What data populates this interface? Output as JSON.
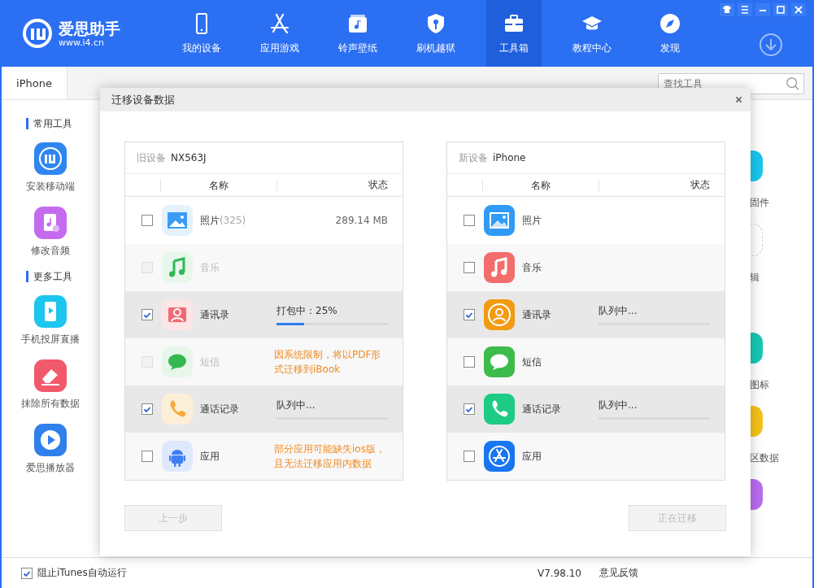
{
  "header": {
    "brand": "爱思助手",
    "url": "www.i4.cn",
    "nav": [
      {
        "label": "我的设备",
        "kind": "phone",
        "selected": false
      },
      {
        "label": "应用游戏",
        "kind": "apps",
        "selected": false
      },
      {
        "label": "铃声壁纸",
        "kind": "ringtone",
        "selected": false
      },
      {
        "label": "刷机越狱",
        "kind": "shield",
        "selected": false
      },
      {
        "label": "工具箱",
        "kind": "toolbox",
        "selected": true
      },
      {
        "label": "教程中心",
        "kind": "cap",
        "selected": false
      },
      {
        "label": "发现",
        "kind": "compass",
        "selected": false
      }
    ]
  },
  "tabs": [
    {
      "label": "iPhone",
      "selected": true
    }
  ],
  "search": {
    "placeholder": "查找工具"
  },
  "sections": [
    {
      "title": "常用工具",
      "tools": [
        {
          "label": "安装移动端",
          "kind": "i4"
        },
        {
          "label": "修改音频",
          "kind": "audio"
        }
      ]
    },
    {
      "title": "更多工具",
      "tools": [
        {
          "label": "手机投屏直播",
          "kind": "mirror"
        },
        {
          "label": "抹除所有数据",
          "kind": "erase"
        },
        {
          "label": "爱思播放器",
          "kind": "player"
        }
      ]
    }
  ],
  "right_tools": [
    {
      "label": "固件",
      "kind": "cyan"
    },
    {
      "label": "辑",
      "kind": "dashed"
    },
    {
      "label": "图标",
      "kind": "teal"
    },
    {
      "label": "区数据",
      "kind": "yellow"
    },
    {
      "kind": "purple"
    }
  ],
  "dialog": {
    "title": "迁移设备数据",
    "panels": [
      {
        "kind": "source",
        "caption": "旧设备",
        "device": "NX563J",
        "columns": [
          "名称",
          "状态"
        ],
        "rows": [
          {
            "name": "照片",
            "count": "(325)",
            "checked": false,
            "disabled": false,
            "status": {
              "kind": "text",
              "text": "289.14 MB"
            }
          },
          {
            "name": "音乐",
            "checked": false,
            "disabled": true
          },
          {
            "name": "通讯录",
            "checked": true,
            "disabled": false,
            "status": {
              "kind": "progress",
              "text": "打包中：25%",
              "level": 0.25
            }
          },
          {
            "name": "短信",
            "checked": false,
            "disabled": true,
            "status": {
              "kind": "note",
              "text": "因系统限制，将以PDF形式迁移到iBook"
            }
          },
          {
            "name": "通话记录",
            "checked": true,
            "disabled": false,
            "status": {
              "kind": "progress",
              "text": "队列中..."
            }
          },
          {
            "name": "应用",
            "checked": false,
            "disabled": false,
            "status": {
              "kind": "note",
              "text": "部分应用可能缺失ios版，且无法迁移应用内数据"
            }
          }
        ]
      },
      {
        "kind": "target",
        "caption": "新设备",
        "device": "iPhone",
        "columns": [
          "名称",
          "状态"
        ],
        "rows": [
          {
            "name": "照片",
            "checked": false,
            "disabled": false
          },
          {
            "name": "音乐",
            "checked": false,
            "disabled": false
          },
          {
            "name": "通讯录",
            "checked": true,
            "disabled": false,
            "status": {
              "kind": "progress",
              "text": "队列中..."
            }
          },
          {
            "name": "短信",
            "checked": false,
            "disabled": false
          },
          {
            "name": "通话记录",
            "checked": true,
            "disabled": false,
            "status": {
              "kind": "progress",
              "text": "队列中..."
            }
          },
          {
            "name": "应用",
            "checked": false,
            "disabled": false
          }
        ]
      }
    ],
    "buttons": [
      {
        "label": "上一步",
        "disabled": true
      },
      {
        "label": "正在迁移",
        "disabled": true
      }
    ]
  },
  "status_bar": {
    "itunes": {
      "label": "阻止iTunes自动运行",
      "checked": true
    },
    "version": "V7.98.10",
    "feedback": "意见反馈"
  }
}
